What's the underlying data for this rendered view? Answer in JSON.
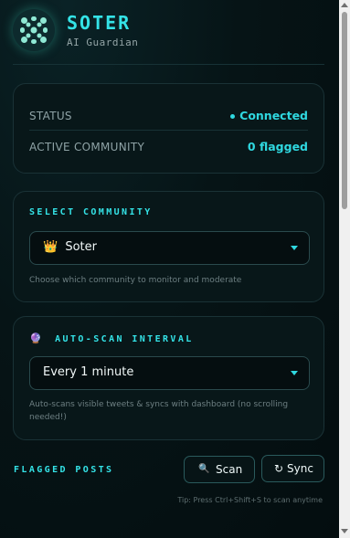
{
  "header": {
    "title": "Soter",
    "subtitle": "AI Guardian"
  },
  "status": {
    "rows": [
      {
        "label": "STATUS",
        "value": "Connected"
      },
      {
        "label": "ACTIVE COMMUNITY",
        "value": "0 flagged"
      }
    ]
  },
  "community": {
    "title": "SELECT COMMUNITY",
    "selected_icon": "👑",
    "selected": "Soter",
    "hint": "Choose which community to monitor and moderate"
  },
  "interval": {
    "title_icon": "🔮",
    "title": "AUTO-SCAN INTERVAL",
    "selected": "Every 1 minute",
    "hint": "Auto-scans visible tweets & syncs with dashboard (no scrolling needed!)"
  },
  "flagged": {
    "title": "FLAGGED POSTS",
    "scan_icon": "🔍",
    "scan_label": "Scan",
    "sync_icon": "↻",
    "sync_label": "Sync",
    "tip": "Tip: Press Ctrl+Shift+S to scan anytime"
  },
  "colors": {
    "accent": "#34e3e7",
    "background": "#051113",
    "card_border": "#1a3236"
  }
}
